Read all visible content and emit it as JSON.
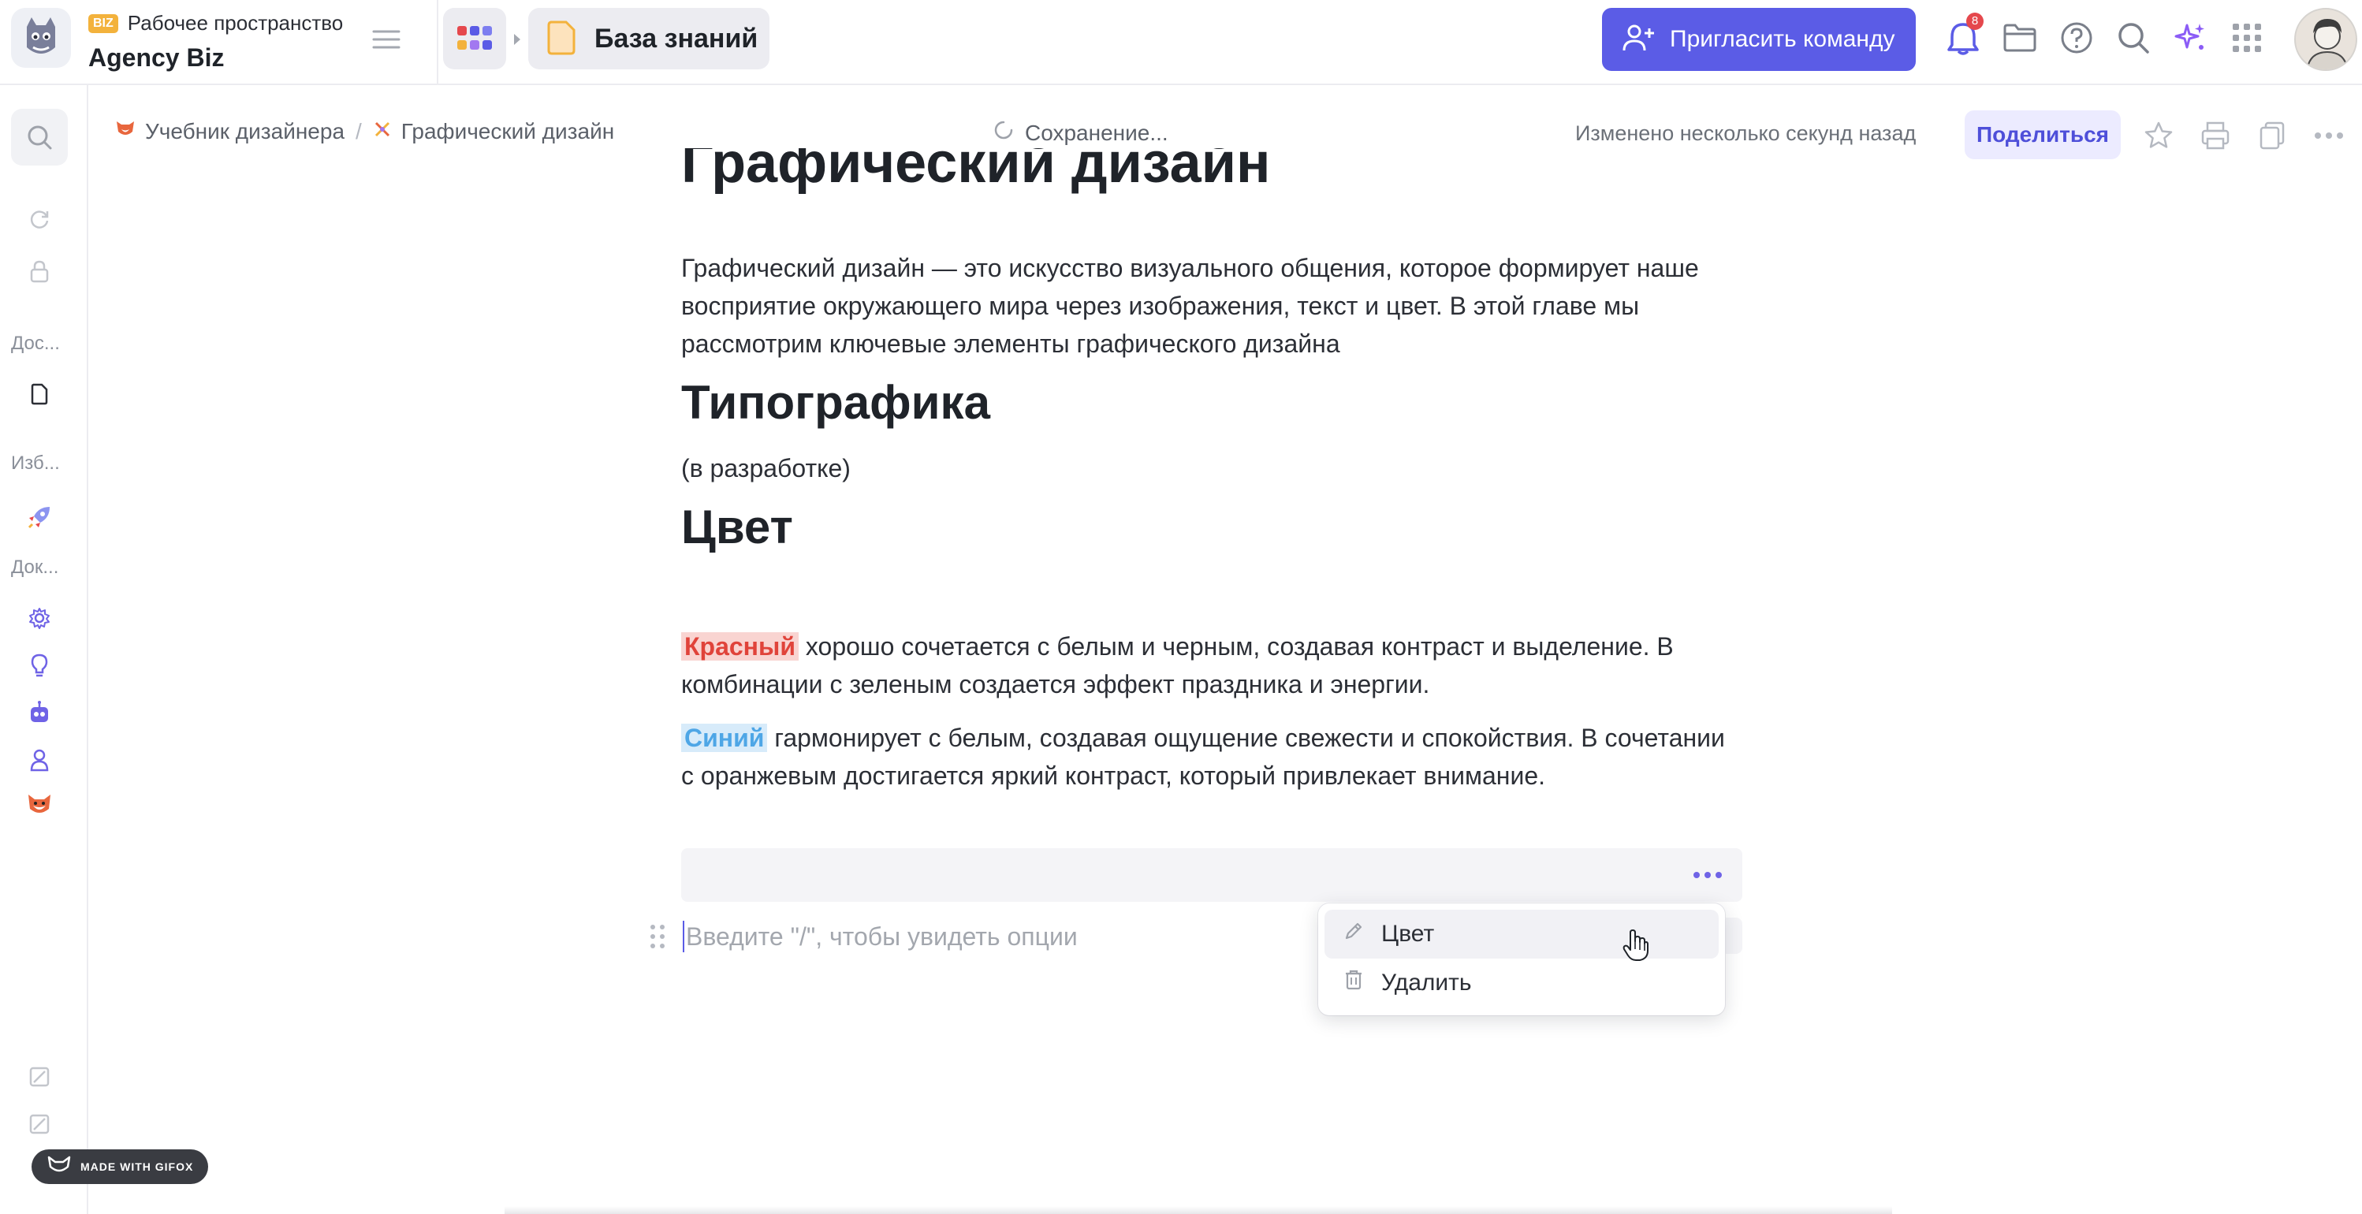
{
  "app": {
    "workspace_badge": "BIZ",
    "workspace_label": "Рабочее пространство",
    "workspace_name": "Agency Biz",
    "section_title": "База знаний",
    "invite_label": "Пригласить команду",
    "notifications_count": "8",
    "accent_color": "#5b5ce6"
  },
  "sidebar": {
    "labels": [
      "Дос...",
      "Изб...",
      "Док..."
    ]
  },
  "subheader": {
    "breadcrumbs": [
      "Учебник дизайнера",
      "Графический дизайн"
    ],
    "breadcrumb_separator": "/",
    "saving_status": "Сохранение...",
    "modified_text": "Изменено несколько секунд назад",
    "share_label": "Поделиться"
  },
  "document": {
    "title": "Графический дизайн",
    "intro": "Графический дизайн — это искусство визуального общения, которое формирует наше восприятие окружающего мира через изображения, текст и цвет. В этой главе мы рассмотрим ключевые элементы графического дизайна",
    "heading_typography": "Типографика",
    "typography_note": "(в разработке)",
    "heading_color": "Цвет",
    "red_word": "Красный",
    "red_text": " хорошо сочетается с белым и черным, создавая контраст и выделение. В комбинации с зеленым создается эффект праздника и энергии.",
    "blue_word": "Синий",
    "blue_text": " гармонирует с белым, создавая ощущение свежести и спокойствия. В сочетании с оранжевым достигается яркий контраст, который привлекает внимание.",
    "editor_placeholder": "Введите \"/\", чтобы увидеть опции"
  },
  "context_menu": {
    "items": [
      {
        "label": "Цвет",
        "icon": "pen-icon"
      },
      {
        "label": "Удалить",
        "icon": "trash-icon"
      }
    ]
  },
  "watermark": "MADE WITH GIFOX"
}
